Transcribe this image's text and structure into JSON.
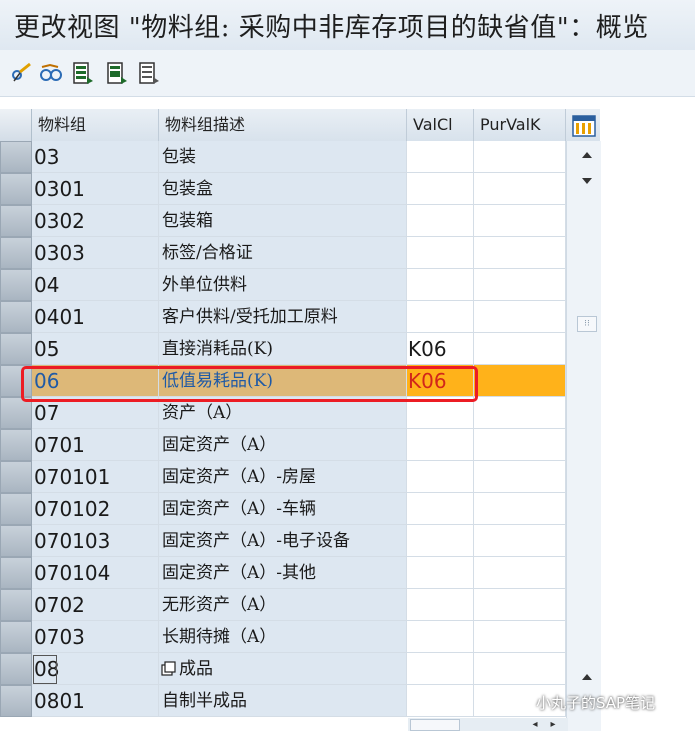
{
  "window": {
    "title": "更改视图 \"物料组: 采购中非库存项目的缺省值\"：概览"
  },
  "toolbar": {
    "buttons": [
      {
        "icon": "edit-glasses-icon",
        "label": ""
      },
      {
        "icon": "toggle-display-change-icon",
        "label": ""
      },
      {
        "icon": "select-all-icon",
        "label": ""
      },
      {
        "icon": "select-block-icon",
        "label": ""
      },
      {
        "icon": "deselect-all-icon",
        "label": ""
      }
    ]
  },
  "table": {
    "columns": [
      "物料组",
      "物料组描述",
      "ValCl",
      "PurValK"
    ],
    "rows": [
      {
        "group": "03",
        "desc": "包装",
        "valcl": "",
        "purvalk": ""
      },
      {
        "group": "0301",
        "desc": "包装盒",
        "valcl": "",
        "purvalk": ""
      },
      {
        "group": "0302",
        "desc": "包装箱",
        "valcl": "",
        "purvalk": ""
      },
      {
        "group": "0303",
        "desc": "标签/合格证",
        "valcl": "",
        "purvalk": ""
      },
      {
        "group": "04",
        "desc": "外单位供料",
        "valcl": "",
        "purvalk": ""
      },
      {
        "group": "0401",
        "desc": "客户供料/受托加工原料",
        "valcl": "",
        "purvalk": ""
      },
      {
        "group": "05",
        "desc": "直接消耗品(K)",
        "valcl": "K06",
        "purvalk": ""
      },
      {
        "group": "06",
        "desc": "低值易耗品(K)",
        "valcl": "K06",
        "purvalk": "",
        "highlighted": true
      },
      {
        "group": "07",
        "desc": "资产（A）",
        "valcl": "",
        "purvalk": ""
      },
      {
        "group": "0701",
        "desc": "固定资产（A）",
        "valcl": "",
        "purvalk": ""
      },
      {
        "group": "070101",
        "desc": "固定资产（A）-房屋",
        "valcl": "",
        "purvalk": ""
      },
      {
        "group": "070102",
        "desc": "固定资产（A）-车辆",
        "valcl": "",
        "purvalk": ""
      },
      {
        "group": "070103",
        "desc": "固定资产（A）-电子设备",
        "valcl": "",
        "purvalk": ""
      },
      {
        "group": "070104",
        "desc": "固定资产（A）-其他",
        "valcl": "",
        "purvalk": ""
      },
      {
        "group": "0702",
        "desc": "无形资产（A）",
        "valcl": "",
        "purvalk": ""
      },
      {
        "group": "0703",
        "desc": "长期待摊（A）",
        "valcl": "",
        "purvalk": ""
      },
      {
        "group": "08",
        "desc": "成品",
        "valcl": "",
        "purvalk": ""
      },
      {
        "group": "0801",
        "desc": "自制半成品",
        "valcl": "",
        "purvalk": ""
      }
    ]
  },
  "watermark": {
    "text": "小丸子的SAP笔记"
  },
  "colors": {
    "highlight_row": "#ddb878",
    "highlight_input": "#ffb21a",
    "annotation_box": "#ec1c24"
  }
}
